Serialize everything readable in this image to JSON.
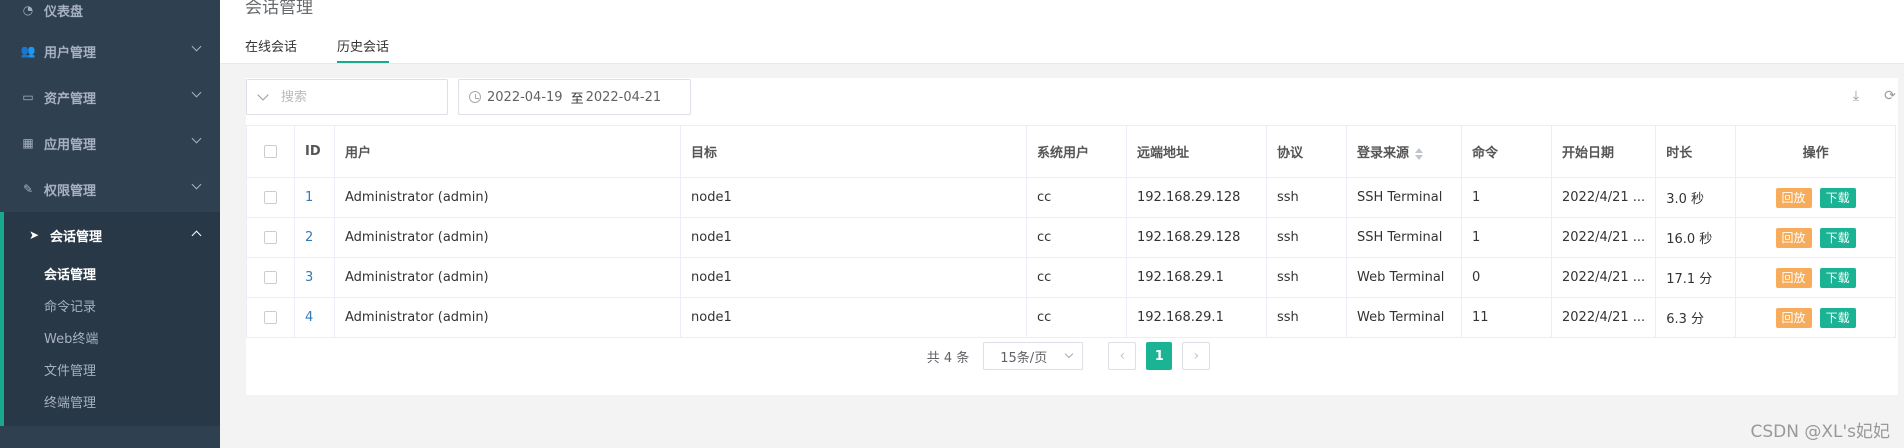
{
  "sidebar": {
    "items": [
      {
        "label": "仪表盘"
      },
      {
        "label": "用户管理"
      },
      {
        "label": "资产管理"
      },
      {
        "label": "应用管理"
      },
      {
        "label": "权限管理"
      },
      {
        "label": "会话管理"
      }
    ],
    "submenu": [
      {
        "label": "会话管理"
      },
      {
        "label": "命令记录"
      },
      {
        "label": "Web终端"
      },
      {
        "label": "文件管理"
      },
      {
        "label": "终端管理"
      }
    ]
  },
  "header": {
    "title": "会话管理",
    "tabs": [
      {
        "label": "在线会话"
      },
      {
        "label": "历史会话"
      }
    ]
  },
  "toolbar": {
    "search_placeholder": "搜索",
    "date_from": "2022-04-19",
    "date_sep": "至",
    "date_to": "2022-04-21"
  },
  "table": {
    "columns": [
      "ID",
      "用户",
      "目标",
      "系统用户",
      "远端地址",
      "协议",
      "登录来源",
      "命令",
      "开始日期",
      "时长",
      "操作"
    ],
    "rows": [
      {
        "id": "1",
        "user": "Administrator (admin)",
        "target": "node1",
        "sysuser": "cc",
        "remote": "192.168.29.128",
        "protocol": "ssh",
        "source": "SSH Terminal",
        "cmd": "1",
        "start": "2022/4/21 ...",
        "duration": "3.0 秒"
      },
      {
        "id": "2",
        "user": "Administrator (admin)",
        "target": "node1",
        "sysuser": "cc",
        "remote": "192.168.29.128",
        "protocol": "ssh",
        "source": "SSH Terminal",
        "cmd": "1",
        "start": "2022/4/21 ...",
        "duration": "16.0 秒"
      },
      {
        "id": "3",
        "user": "Administrator (admin)",
        "target": "node1",
        "sysuser": "cc",
        "remote": "192.168.29.1",
        "protocol": "ssh",
        "source": "Web Terminal",
        "cmd": "0",
        "start": "2022/4/21 ...",
        "duration": "17.1 分"
      },
      {
        "id": "4",
        "user": "Administrator (admin)",
        "target": "node1",
        "sysuser": "cc",
        "remote": "192.168.29.1",
        "protocol": "ssh",
        "source": "Web Terminal",
        "cmd": "11",
        "start": "2022/4/21 ...",
        "duration": "6.3 分"
      }
    ],
    "btn_replay": "回放",
    "btn_download": "下载"
  },
  "pagination": {
    "total": "共 4 条",
    "page_size": "15条/页",
    "current": "1"
  },
  "watermark": "CSDN @XL's妃妃",
  "colors": {
    "sidebar_bg": "#2f4050",
    "accent": "#1ab394",
    "replay": "#f8ac59",
    "link": "#337ab7"
  }
}
